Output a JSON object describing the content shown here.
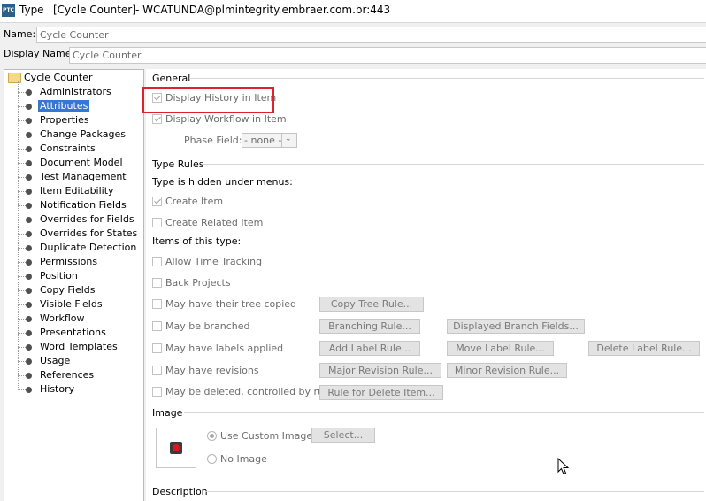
{
  "window": {
    "logo_text": "PTC",
    "title_type": "Type",
    "title_main": "[Cycle Counter]",
    "title_user": "- WCATUNDA@plmintegrity.embraer.com.br:443"
  },
  "fields": {
    "name_label": "Name:",
    "name_value": "Cycle Counter",
    "display_name_label": "Display Name:",
    "display_name_value": "Cycle Counter"
  },
  "tree": {
    "root": "Cycle Counter",
    "selected_index": 1,
    "items": [
      "Administrators",
      "Attributes",
      "Properties",
      "Change Packages",
      "Constraints",
      "Document Model",
      "Test Management",
      "Item Editability",
      "Notification Fields",
      "Overrides for Fields",
      "Overrides for States",
      "Duplicate Detection",
      "Permissions",
      "Position",
      "Copy Fields",
      "Visible Fields",
      "Workflow",
      "Presentations",
      "Word Templates",
      "Usage",
      "References",
      "History"
    ]
  },
  "general": {
    "section": "General",
    "display_history": "Display History in Item",
    "display_workflow": "Display Workflow in Item",
    "phase_field_label": "Phase Field:",
    "phase_field_value": "- none -"
  },
  "type_rules": {
    "section": "Type Rules",
    "hidden_label": "Type is hidden under menus:",
    "create_item": "Create Item",
    "create_related_item": "Create Related Item",
    "items_label": "Items of this type:",
    "allow_time_tracking": "Allow Time Tracking",
    "back_projects": "Back Projects",
    "tree_copied": "May have their tree copied",
    "branched": "May be branched",
    "labels": "May have labels applied",
    "revisions": "May have revisions",
    "deleted": "May be deleted, controlled by rule",
    "btn_copy_tree": "Copy Tree Rule...",
    "btn_branching": "Branching Rule...",
    "btn_displayed_branch": "Displayed Branch Fields...",
    "btn_add_label": "Add Label Rule...",
    "btn_move_label": "Move Label Rule...",
    "btn_delete_label": "Delete Label Rule...",
    "btn_major_rev": "Major Revision Rule...",
    "btn_minor_rev": "Minor Revision Rule...",
    "btn_delete_item": "Rule for Delete Item..."
  },
  "image": {
    "section": "Image",
    "use_custom": "Use Custom Image",
    "no_image": "No Image",
    "select_btn": "Select..."
  },
  "description": {
    "section": "Description"
  },
  "colors": {
    "selection": "#3875d7",
    "highlight": "#d8242c"
  }
}
